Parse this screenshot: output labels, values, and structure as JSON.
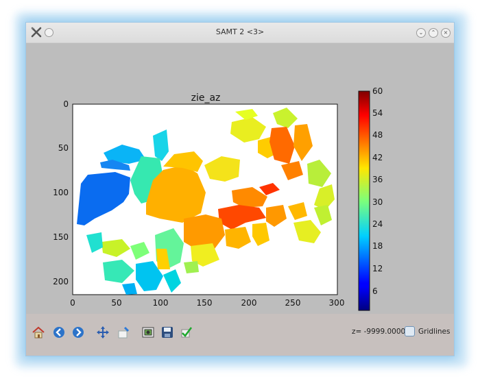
{
  "window": {
    "title": "SAMT 2 <3>",
    "app_icon": "tools-icon",
    "buttons": [
      "minimize-icon",
      "maximize-icon",
      "close-icon"
    ]
  },
  "plot": {
    "title": "zie_az",
    "x_ticks": [
      "0",
      "50",
      "100",
      "150",
      "200",
      "250",
      "300"
    ],
    "y_ticks": [
      "0",
      "50",
      "100",
      "150",
      "200"
    ],
    "colorbar_ticks": [
      "60",
      "54",
      "48",
      "42",
      "36",
      "30",
      "24",
      "18",
      "12",
      "6"
    ],
    "colormap": "jet",
    "value_range": [
      0,
      60
    ]
  },
  "toolbar": {
    "icons": [
      "home-icon",
      "back-icon",
      "forward-icon",
      "pan-icon",
      "zoom-icon",
      "configure-subplots-icon",
      "save-icon",
      "check-icon"
    ],
    "z_readout": "z= -9999.0000",
    "gridlines_label": "Gridlines",
    "gridlines_checked": false
  },
  "colors": {
    "accent_glow": "#7cc0ec",
    "background": "#bdbdbd"
  }
}
